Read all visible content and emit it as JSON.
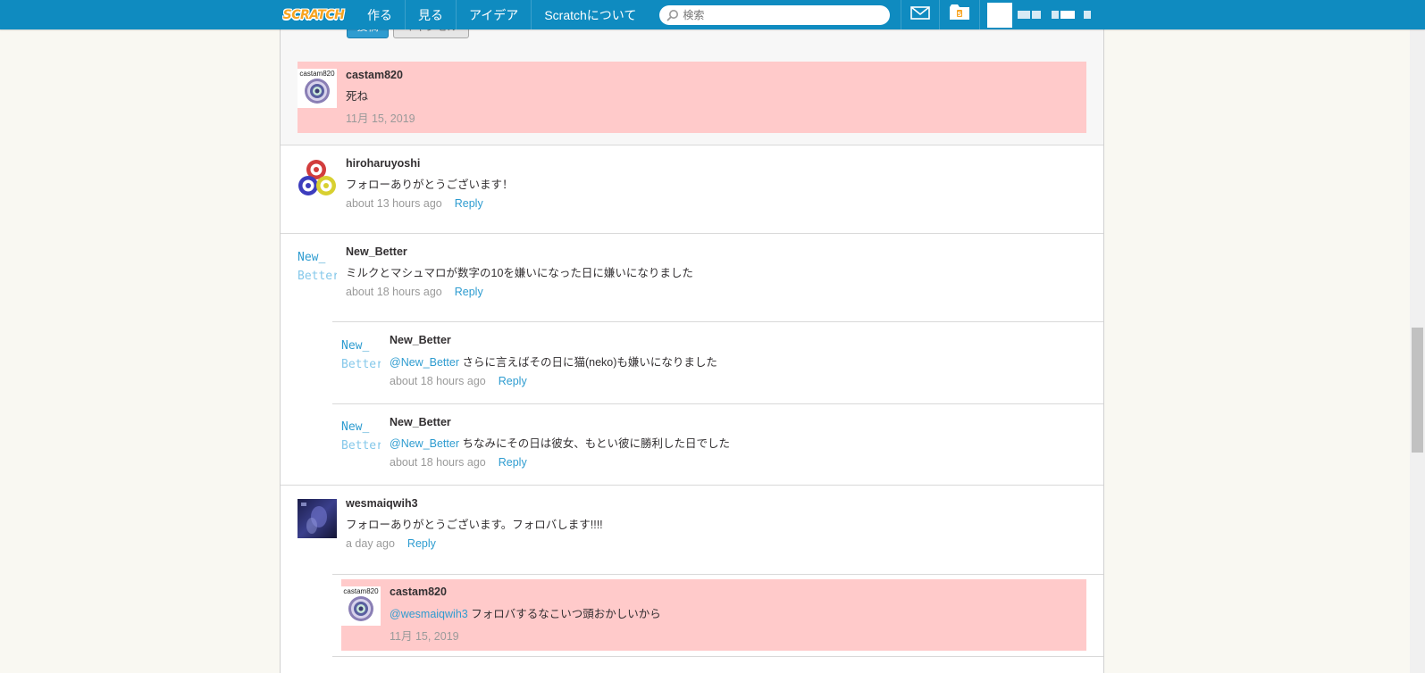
{
  "nav": {
    "logo_text": "SCRATCH",
    "items": [
      "作る",
      "見る",
      "アイデア",
      "Scratchについて"
    ],
    "search_placeholder": "検索"
  },
  "form": {
    "post_label": "投稿",
    "cancel_label": "キャンセル"
  },
  "comments": [
    {
      "user": "castam820",
      "avatar_text": "castam820",
      "text": "死ね",
      "mention": "",
      "time": "11月 15, 2019",
      "reply_label": ""
    },
    {
      "user": "hiroharuyoshi",
      "text": "フォローありがとうございます！",
      "mention": "",
      "time": "about 13 hours ago",
      "reply_label": "Reply"
    },
    {
      "user": "New_Better",
      "avatar_line1": "New_",
      "avatar_line2": "Better",
      "text": "ミルクとマシュマロが数字の10を嫌いになった日に嫌いになりました",
      "mention": "",
      "time": "about 18 hours ago",
      "reply_label": "Reply"
    },
    {
      "user": "New_Better",
      "avatar_line1": "New_",
      "avatar_line2": "Better",
      "mention": "@New_Better",
      "text": " さらに言えばその日に猫(neko)も嫌いになりました",
      "time": "about 18 hours ago",
      "reply_label": "Reply"
    },
    {
      "user": "New_Better",
      "avatar_line1": "New_",
      "avatar_line2": "Better",
      "mention": "@New_Better",
      "text": " ちなみにその日は彼女、もとい彼に勝利した日でした",
      "time": "about 18 hours ago",
      "reply_label": "Reply"
    },
    {
      "user": "wesmaiqwih3",
      "text": "フォローありがとうございます。フォロバします!!!!",
      "mention": "",
      "time": "a day ago",
      "reply_label": "Reply"
    },
    {
      "user": "castam820",
      "avatar_text": "castam820",
      "mention": "@wesmaiqwih3",
      "text": " フォロバするなこいつ頭おかしいから",
      "time": "11月 15, 2019",
      "reply_label": ""
    }
  ],
  "colors": {
    "nav_bg": "#0f8bc0",
    "highlight": "#ffcaca",
    "link": "#2e9cd0"
  }
}
